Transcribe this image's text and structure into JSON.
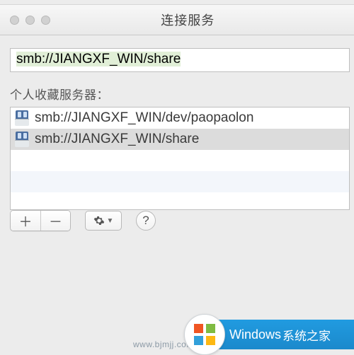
{
  "window": {
    "title": "连接服务"
  },
  "address": {
    "value": "smb://JIANGXF_WIN/share"
  },
  "favorites": {
    "label": "个人收藏服务器：",
    "items": [
      {
        "url": "smb://JIANGXF_WIN/dev/paopaolon",
        "selected": false
      },
      {
        "url": "smb://JIANGXF_WIN/share",
        "selected": true
      }
    ]
  },
  "toolbar": {
    "add": "＋",
    "remove": "－",
    "help": "?"
  },
  "watermark": "www.bjmjj.com",
  "badge": {
    "text1": "Windows",
    "text2": "系统之家"
  }
}
